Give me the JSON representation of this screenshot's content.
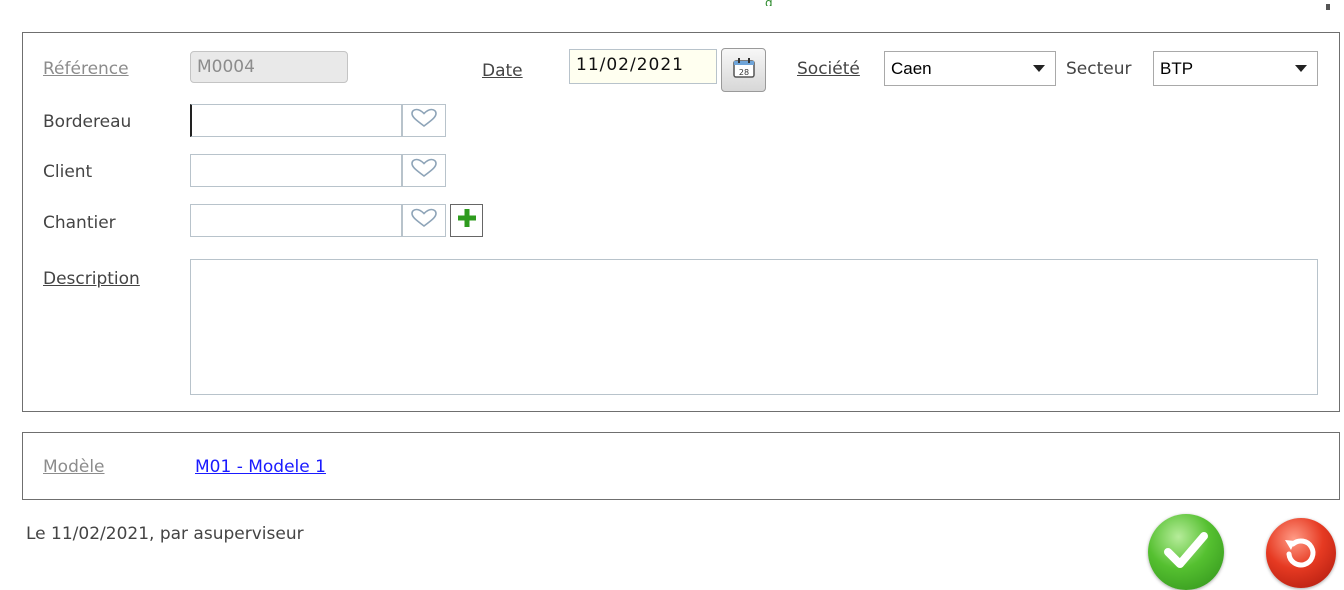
{
  "header": {
    "cut_mark": "g"
  },
  "form": {
    "reference": {
      "label": "Référence",
      "value": "M0004"
    },
    "date": {
      "label": "Date",
      "value": "11/02/2021",
      "calendar_day": "28"
    },
    "societe": {
      "label": "Société",
      "selected": "Caen"
    },
    "secteur": {
      "label": "Secteur",
      "selected": "BTP"
    },
    "bordereau": {
      "label": "Bordereau",
      "value": ""
    },
    "client": {
      "label": "Client",
      "value": ""
    },
    "chantier": {
      "label": "Chantier",
      "value": ""
    },
    "description": {
      "label": "Description",
      "value": ""
    }
  },
  "modele": {
    "label": "Modèle",
    "link": "M01 - Modele 1"
  },
  "footer": {
    "status": "Le 11/02/2021, par asuperviseur"
  },
  "icons": {
    "picker": "heart-icon",
    "calendar": "calendar-icon",
    "add": "plus-icon",
    "validate": "checkmark-icon",
    "cancel": "undo-icon"
  },
  "colors": {
    "accent_green": "#2e9b1e",
    "cancel_red": "#d62a1c",
    "link_blue": "#1a1aff",
    "date_bg": "#fffff0"
  }
}
